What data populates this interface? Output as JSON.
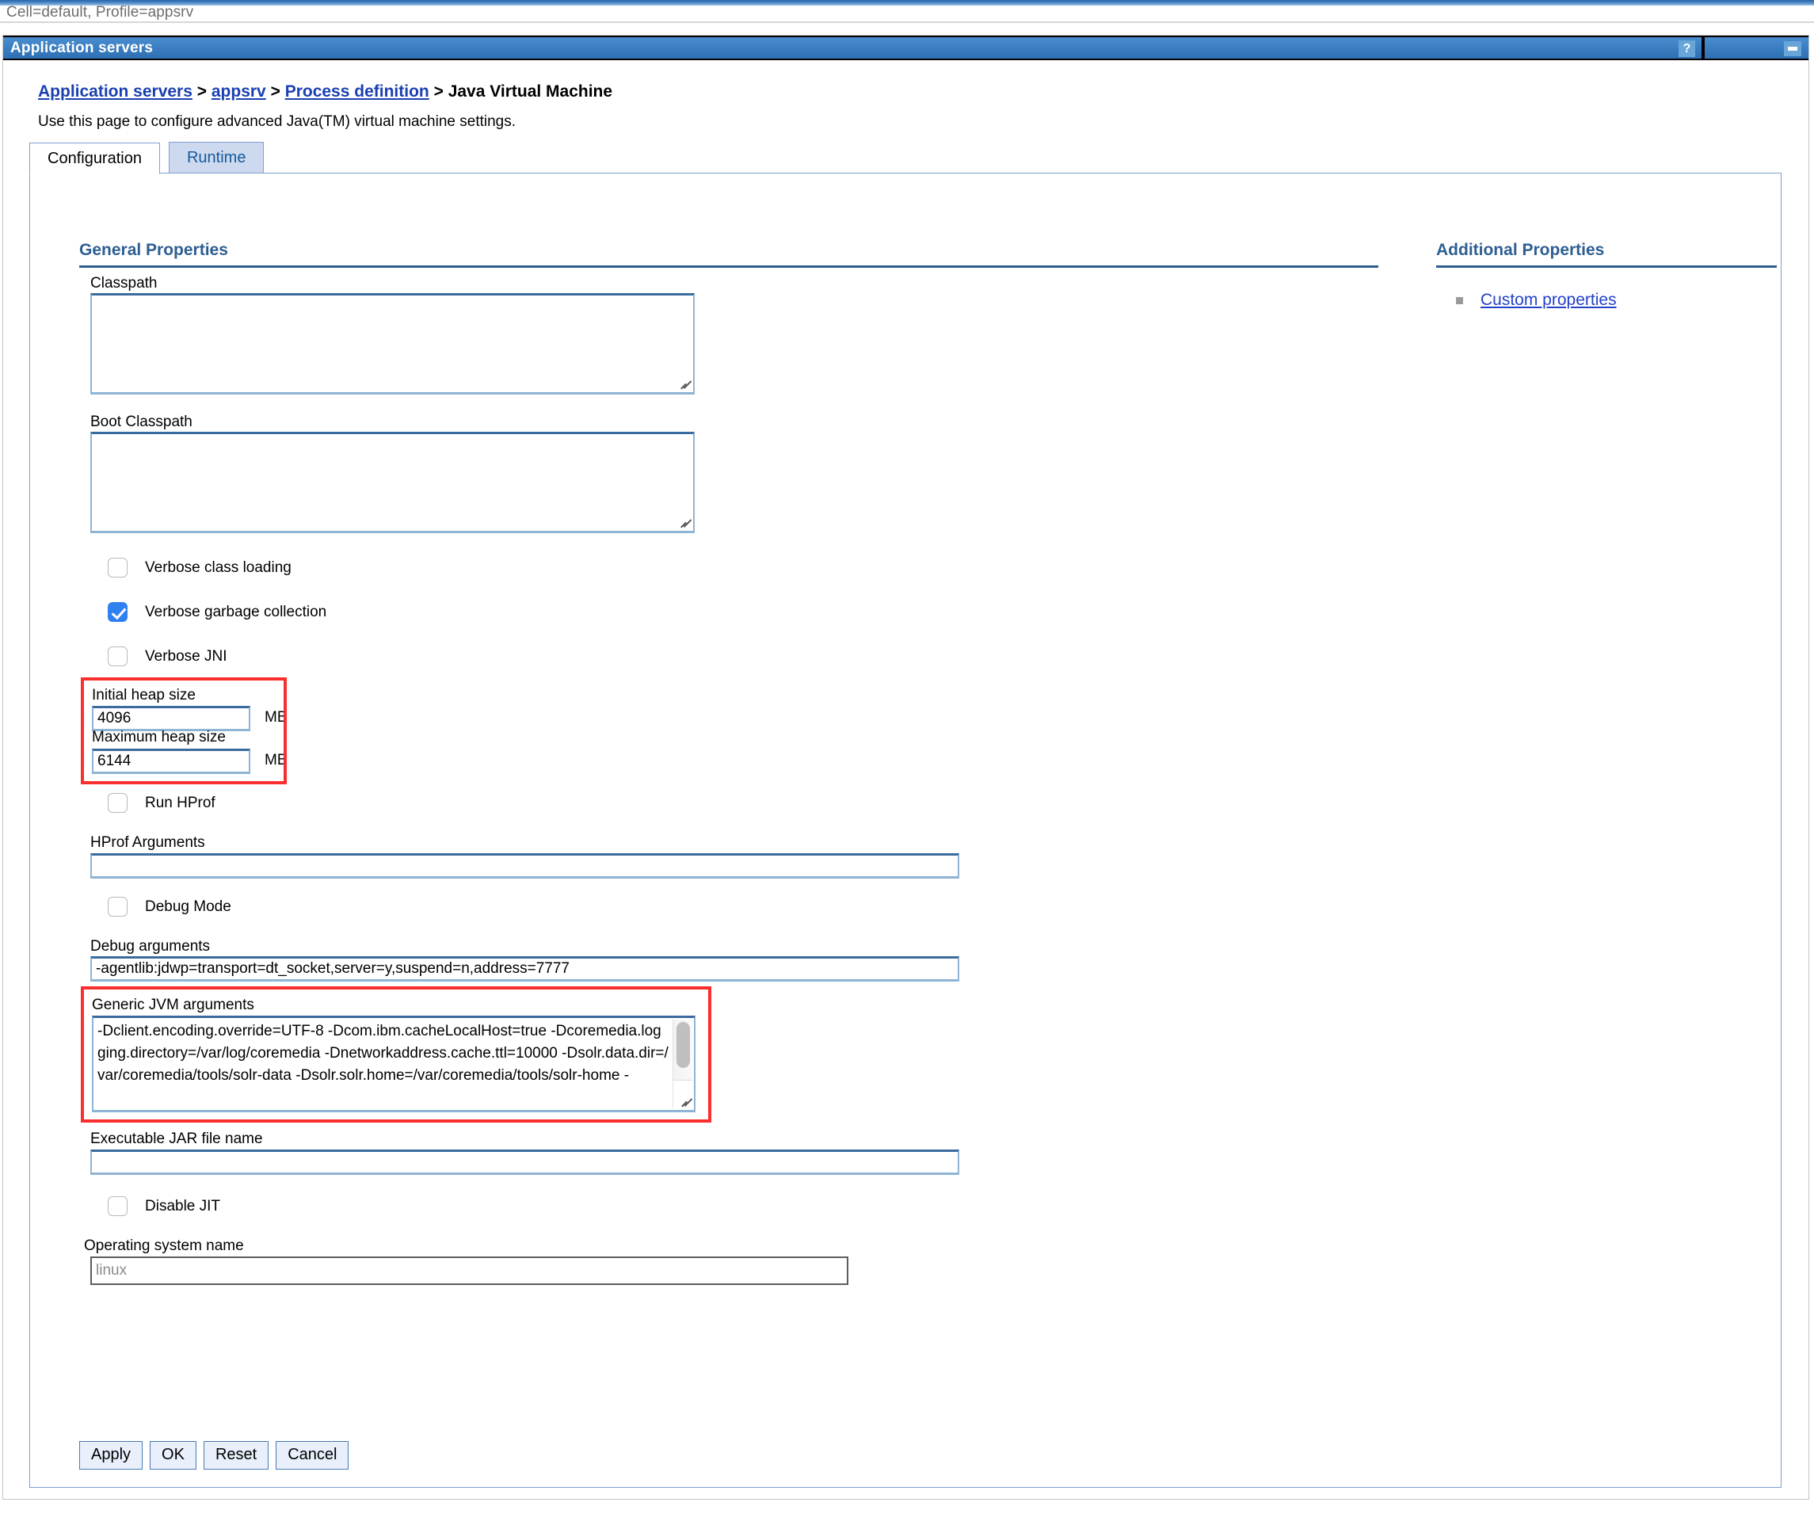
{
  "status_bar": {
    "text": "Cell=default, Profile=appsrv"
  },
  "portlet": {
    "title": "Application servers",
    "help_icon": "?",
    "minimize_icon": "minimize"
  },
  "breadcrumb": {
    "item1": "Application servers",
    "sep1": ">",
    "item2": "appsrv",
    "sep2": ">",
    "item3": "Process definition",
    "sep3": ">",
    "current": "Java Virtual Machine"
  },
  "intro_text": "Use this page to configure advanced Java(TM) virtual machine settings.",
  "tabs": [
    {
      "label": "Configuration",
      "active": true
    },
    {
      "label": "Runtime",
      "active": false
    }
  ],
  "sections": {
    "general_properties": "General Properties",
    "additional_properties": "Additional Properties"
  },
  "additional_properties": {
    "links": [
      {
        "label": "Custom properties"
      }
    ]
  },
  "fields": {
    "classpath": {
      "label": "Classpath",
      "value": ""
    },
    "boot_classpath": {
      "label": "Boot Classpath",
      "value": ""
    },
    "verbose_class_loading": {
      "label": "Verbose class loading",
      "checked": false
    },
    "verbose_gc": {
      "label": "Verbose garbage collection",
      "checked": true
    },
    "verbose_jni": {
      "label": "Verbose JNI",
      "checked": false
    },
    "initial_heap_size": {
      "label": "Initial heap size",
      "value": "4096",
      "unit": "MB"
    },
    "maximum_heap_size": {
      "label": "Maximum heap size",
      "value": "6144",
      "unit": "MB"
    },
    "run_hprof": {
      "label": "Run HProf",
      "checked": false
    },
    "hprof_arguments": {
      "label": "HProf Arguments",
      "value": ""
    },
    "debug_mode": {
      "label": "Debug Mode",
      "checked": false
    },
    "debug_arguments": {
      "label": "Debug arguments",
      "value": "-agentlib:jdwp=transport=dt_socket,server=y,suspend=n,address=7777"
    },
    "generic_jvm_arguments": {
      "label": "Generic JVM arguments",
      "value": "-Dclient.encoding.override=UTF-8 -Dcom.ibm.cacheLocalHost=true -Dcoremedia.logging.directory=/var/log/coremedia -Dnetworkaddress.cache.ttl=10000 -Dsolr.data.dir=/var/coremedia/tools/solr-data -Dsolr.solr.home=/var/coremedia/tools/solr-home -"
    },
    "executable_jar": {
      "label": "Executable JAR file name",
      "value": ""
    },
    "disable_jit": {
      "label": "Disable JIT",
      "checked": false
    },
    "operating_system_name": {
      "label": "Operating system name",
      "value": "",
      "placeholder": "linux"
    }
  },
  "buttons": [
    {
      "label": "Apply"
    },
    {
      "label": "OK"
    },
    {
      "label": "Reset"
    },
    {
      "label": "Cancel"
    }
  ],
  "colors": {
    "title_bar_blue": "#3b7ec2",
    "link_blue": "#1a3fb0",
    "section_heading": "#2e5e91",
    "annotation_red": "#fb2e2e",
    "checkbox_checked": "#2f80f0"
  }
}
